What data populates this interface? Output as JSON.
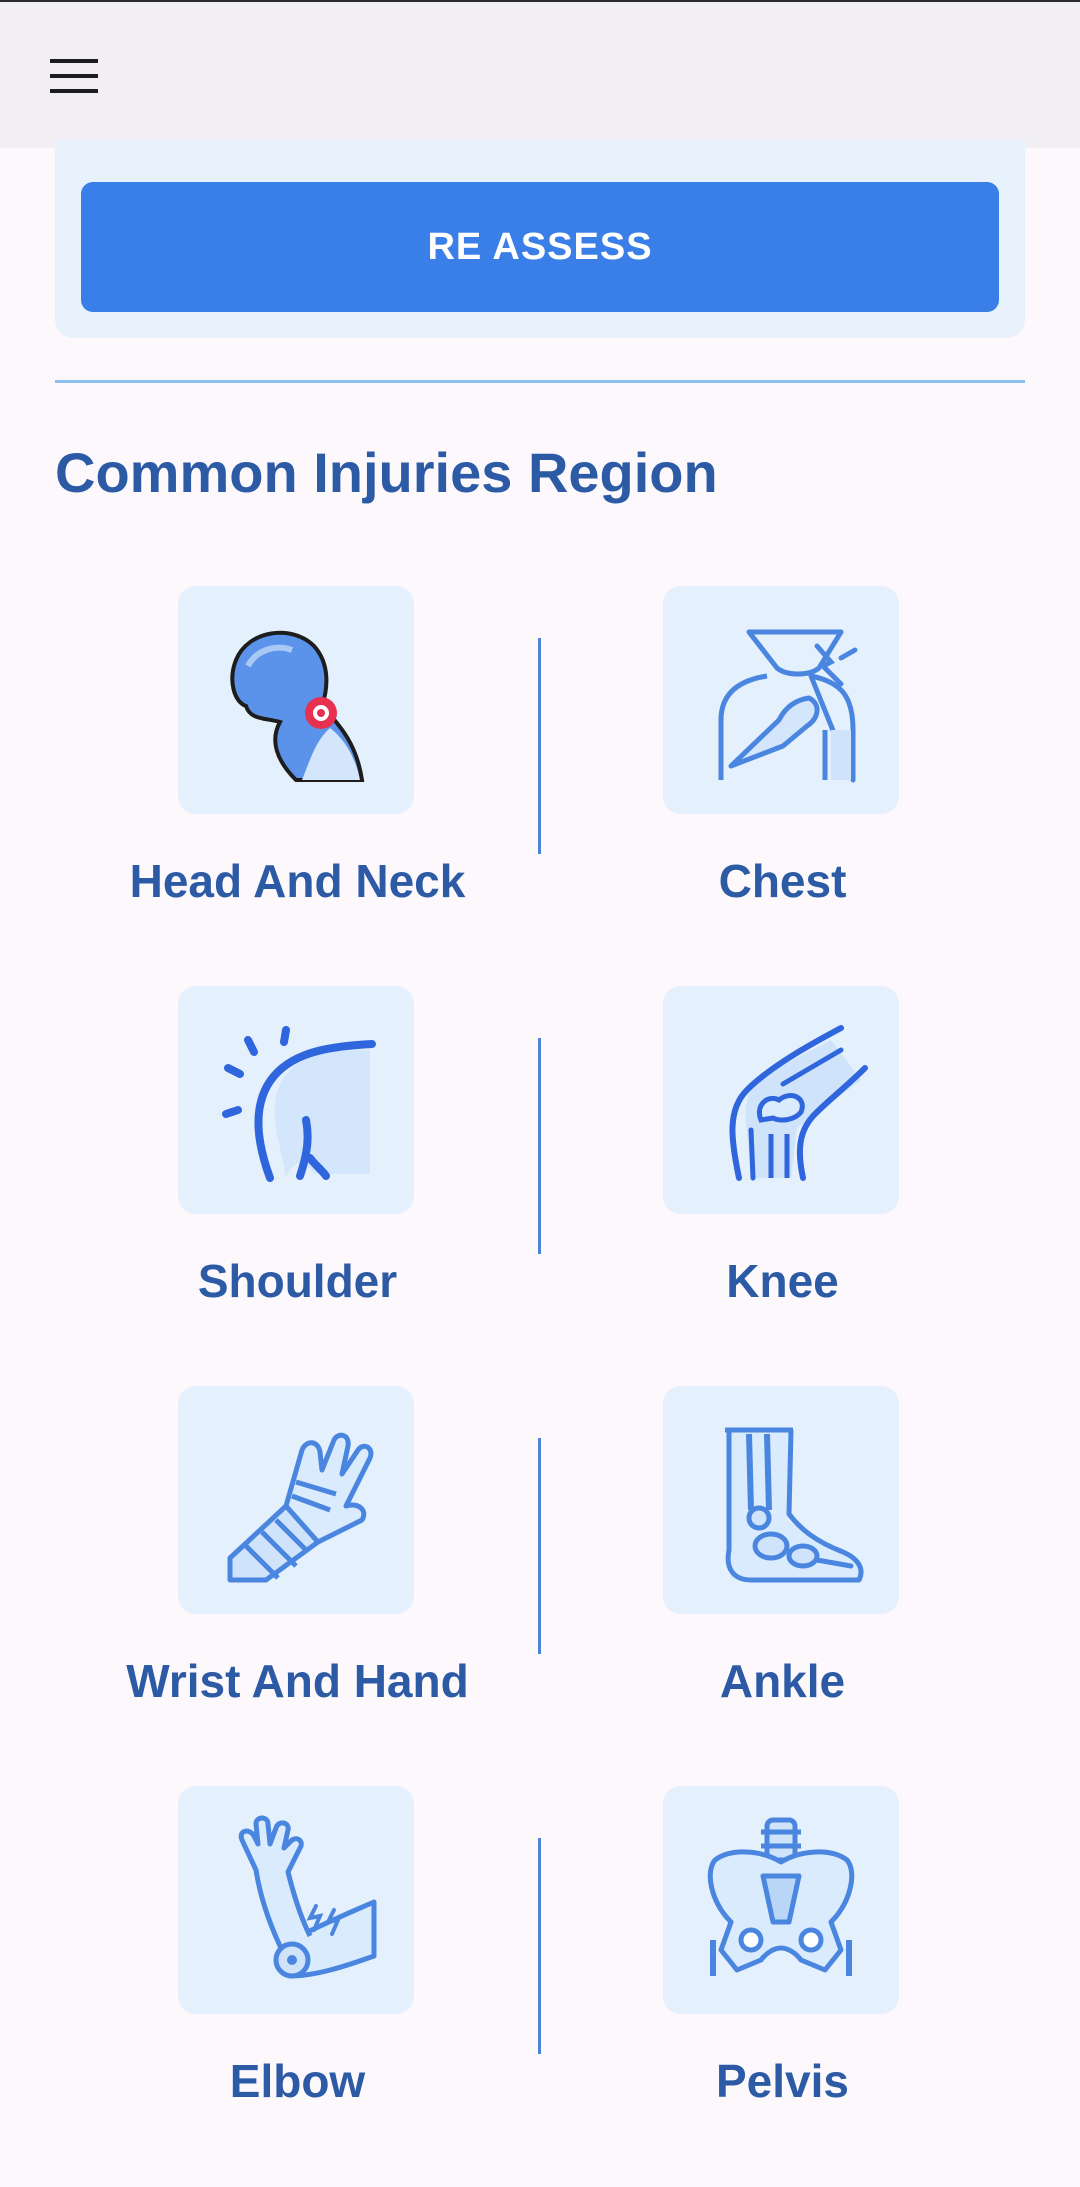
{
  "app_bar": {
    "menu_icon": "hamburger-menu-icon"
  },
  "assessment_card": {
    "reassess_label": "RE ASSESS"
  },
  "section": {
    "title": "Common Injuries Region"
  },
  "colors": {
    "accent": "#3a7ee7",
    "title": "#2c5aa4",
    "tile_bg": "#e4f0fc",
    "divider": "#8cc0ea"
  },
  "regions": [
    {
      "label": "Head And Neck",
      "icon": "head-neck-icon"
    },
    {
      "label": "Chest",
      "icon": "chest-icon"
    },
    {
      "label": "Shoulder",
      "icon": "shoulder-icon"
    },
    {
      "label": "Knee",
      "icon": "knee-icon"
    },
    {
      "label": "Wrist And Hand",
      "icon": "wrist-hand-icon"
    },
    {
      "label": "Ankle",
      "icon": "ankle-icon"
    },
    {
      "label": "Elbow",
      "icon": "elbow-icon"
    },
    {
      "label": "Pelvis",
      "icon": "pelvis-icon"
    }
  ]
}
